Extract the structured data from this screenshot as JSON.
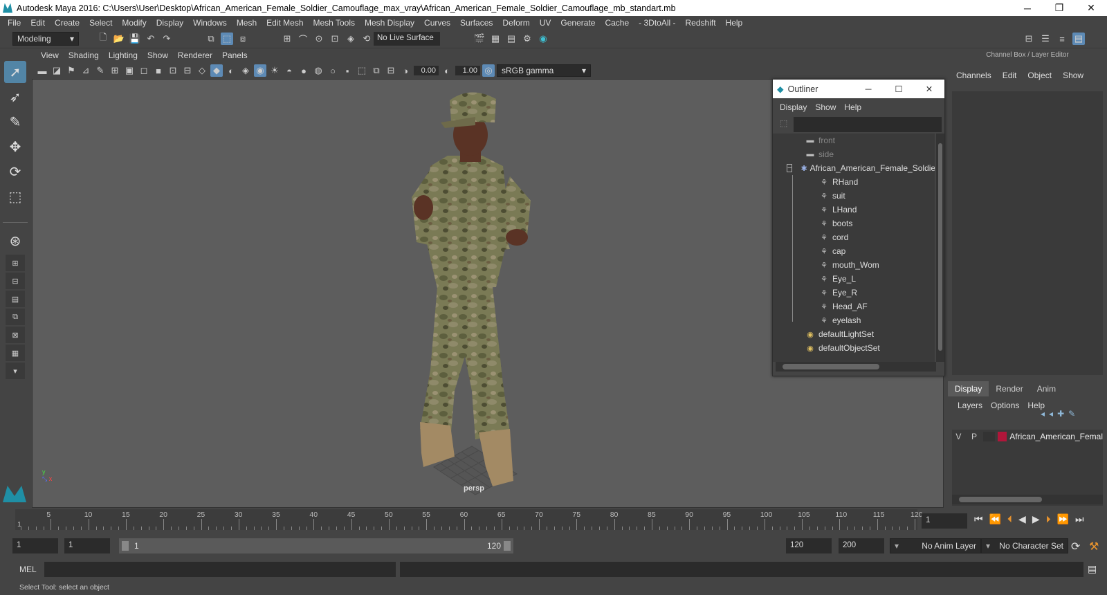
{
  "titlebar": {
    "title": "Autodesk Maya 2016: C:\\Users\\User\\Desktop\\African_American_Female_Soldier_Camouflage_max_vray\\African_American_Female_Soldier_Camouflage_mb_standart.mb",
    "minimize": "─",
    "maximize": "❐",
    "close": "✕"
  },
  "menubar": [
    "File",
    "Edit",
    "Create",
    "Select",
    "Modify",
    "Display",
    "Windows",
    "Mesh",
    "Edit Mesh",
    "Mesh Tools",
    "Mesh Display",
    "Curves",
    "Surfaces",
    "Deform",
    "UV",
    "Generate",
    "Cache",
    "- 3DtoAll -",
    "Redshift",
    "Help"
  ],
  "statusline": {
    "mode": "Modeling",
    "live_surface": "No Live Surface"
  },
  "viewport": {
    "menu": [
      "View",
      "Shading",
      "Lighting",
      "Show",
      "Renderer",
      "Panels"
    ],
    "exposure": "0.00",
    "gamma": "1.00",
    "colorspace": "sRGB gamma",
    "camera_label": "persp"
  },
  "outliner": {
    "title": "Outliner",
    "menu": [
      "Display",
      "Show",
      "Help"
    ],
    "items": [
      {
        "label": "front",
        "depth": 2,
        "icon": "camera-icon",
        "dim": true
      },
      {
        "label": "side",
        "depth": 2,
        "icon": "camera-icon",
        "dim": true
      },
      {
        "label": "African_American_Female_Soldier",
        "depth": 1,
        "icon": "group-icon",
        "dim": false
      },
      {
        "label": "RHand",
        "depth": 3,
        "icon": "mesh-icon",
        "dim": false
      },
      {
        "label": "suit",
        "depth": 3,
        "icon": "mesh-icon",
        "dim": false
      },
      {
        "label": "LHand",
        "depth": 3,
        "icon": "mesh-icon",
        "dim": false
      },
      {
        "label": "boots",
        "depth": 3,
        "icon": "mesh-icon",
        "dim": false
      },
      {
        "label": "cord",
        "depth": 3,
        "icon": "mesh-icon",
        "dim": false
      },
      {
        "label": "cap",
        "depth": 3,
        "icon": "mesh-icon",
        "dim": false
      },
      {
        "label": "mouth_Wom",
        "depth": 3,
        "icon": "mesh-icon",
        "dim": false
      },
      {
        "label": "Eye_L",
        "depth": 3,
        "icon": "mesh-icon",
        "dim": false
      },
      {
        "label": "Eye_R",
        "depth": 3,
        "icon": "mesh-icon",
        "dim": false
      },
      {
        "label": "Head_AF",
        "depth": 3,
        "icon": "mesh-icon",
        "dim": false
      },
      {
        "label": "eyelash",
        "depth": 3,
        "icon": "mesh-icon",
        "dim": false
      },
      {
        "label": "defaultLightSet",
        "depth": 2,
        "icon": "set-icon",
        "dim": false
      },
      {
        "label": "defaultObjectSet",
        "depth": 2,
        "icon": "set-icon",
        "dim": false
      }
    ]
  },
  "channelbox": {
    "title": "Channel Box / Layer Editor",
    "menu": [
      "Channels",
      "Edit",
      "Object",
      "Show"
    ]
  },
  "layer_editor": {
    "tabs": [
      "Display",
      "Render",
      "Anim"
    ],
    "menu": [
      "Layers",
      "Options",
      "Help"
    ],
    "layer": {
      "v": "V",
      "p": "P",
      "name": "African_American_Femal",
      "color": "#b0163a"
    }
  },
  "timeline": {
    "ticks": [
      "5",
      "10",
      "15",
      "20",
      "25",
      "30",
      "35",
      "40",
      "45",
      "50",
      "55",
      "60",
      "65",
      "70",
      "75",
      "80",
      "85",
      "90",
      "95",
      "100",
      "105",
      "110",
      "115",
      "120"
    ],
    "start_marker": "1",
    "current_frame": "1"
  },
  "range": {
    "start": "1",
    "playback_start": "1",
    "slider_start": "1",
    "slider_end": "120",
    "playback_end": "120",
    "end": "200",
    "anim_layer": "No Anim Layer",
    "character_set": "No Character Set"
  },
  "cmdline": {
    "label": "MEL"
  },
  "helpline": "Select Tool: select an object",
  "colors": {
    "accent": "#5285a6",
    "layer_red": "#b0163a"
  }
}
